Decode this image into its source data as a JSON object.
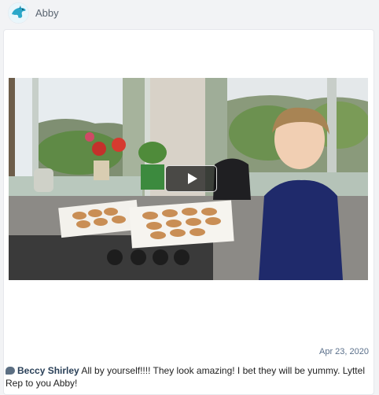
{
  "header": {
    "user_name": "Abby",
    "avatar_icon": "dolphin-icon",
    "accent": "#2aa7c9"
  },
  "post": {
    "video": {
      "play_icon": "play-icon"
    },
    "date": "Apr 23, 2020",
    "comment": {
      "icon": "comment-icon",
      "author": "Beccy Shirley",
      "text": "All by yourself!!!! They look amazing! I bet they will be yummy. Lyttel Rep to you Abby!"
    }
  }
}
